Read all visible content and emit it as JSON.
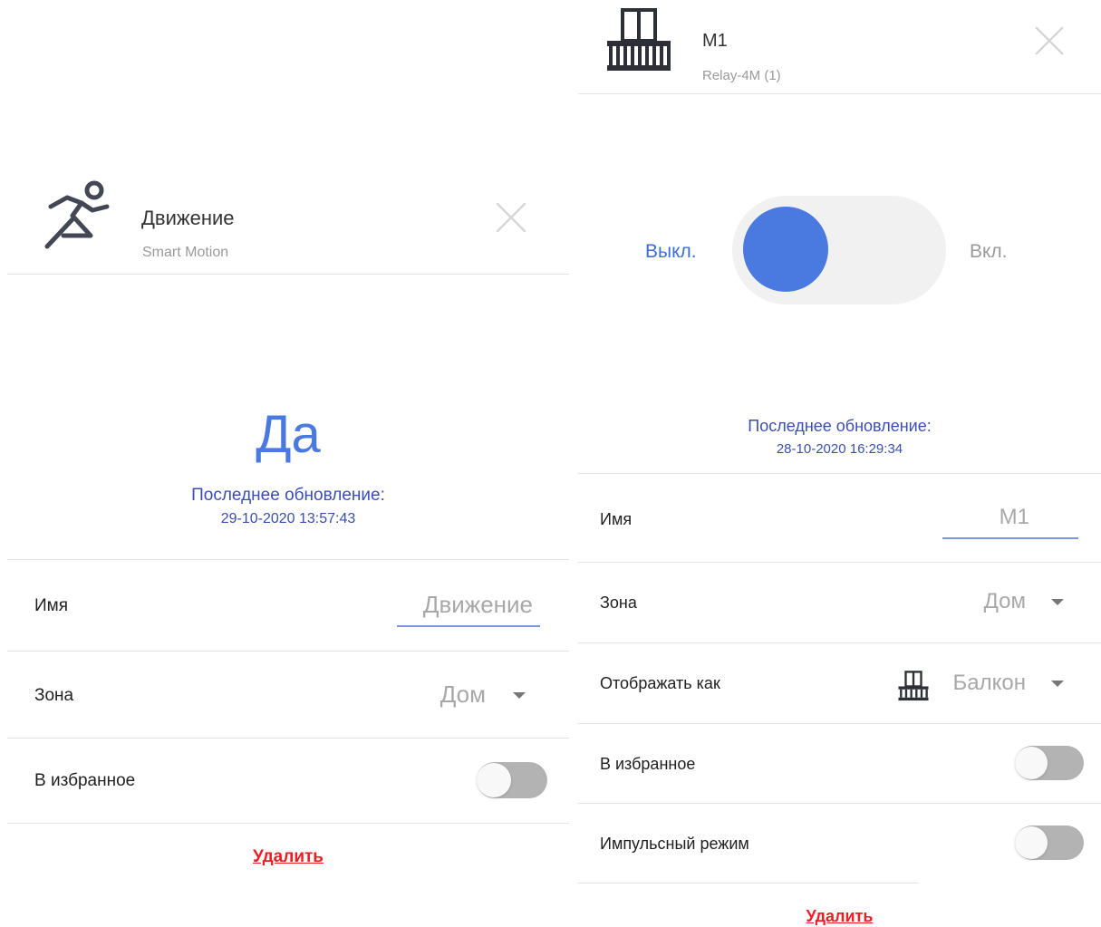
{
  "left_panel": {
    "title": "Движение",
    "subtitle": "Smart Motion",
    "header_icon": "running-person-icon",
    "state_value": "Да",
    "last_update_label": "Последнее обновление:",
    "last_update_time": "29-10-2020 13:57:43",
    "name_label": "Имя",
    "name_value": "Движение",
    "zone_label": "Зона",
    "zone_value": "Дом",
    "favorite_label": "В избранное",
    "favorite_on": false,
    "delete_label": "Удалить"
  },
  "right_panel": {
    "title": "M1",
    "subtitle": "Relay-4M (1)",
    "header_icon": "balcony-icon",
    "switch_off_label": "Выкл.",
    "switch_on_label": "Вкл.",
    "switch_state_on": false,
    "last_update_label": "Последнее обновление:",
    "last_update_time": "28-10-2020 16:29:34",
    "name_label": "Имя",
    "name_value": "M1",
    "zone_label": "Зона",
    "zone_value": "Дом",
    "display_as_label": "Отображать как",
    "display_as_value": "Балкон",
    "display_as_icon": "balcony-icon",
    "favorite_label": "В избранное",
    "favorite_on": false,
    "pulse_label": "Импульсный режим",
    "pulse_on": false,
    "delete_label": "Удалить"
  },
  "colors": {
    "accent": "#4a7ae0",
    "update_text": "#3a4fb0",
    "delete": "#ee1d23",
    "toggle_off_track": "#b3b3b3"
  }
}
